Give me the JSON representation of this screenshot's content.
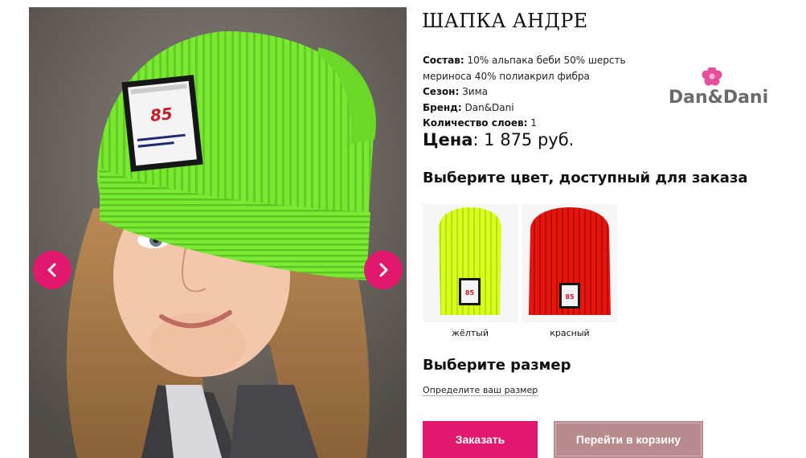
{
  "product": {
    "title": "ШАПКА АНДРЕ",
    "specs": [
      {
        "label": "Состав",
        "value": "10% альпака беби 50% шерсть мериноса 40% полиакрил фибра"
      },
      {
        "label": "Сезон",
        "value": "Зима"
      },
      {
        "label": "Бренд",
        "value": "Dan&Dani"
      },
      {
        "label": "Количество слоев",
        "value": "1"
      }
    ],
    "price_label": "Цена",
    "price_value": "1 875 руб."
  },
  "brand": {
    "name": "Dan&Dani",
    "icon": "flower-icon"
  },
  "gallery": {
    "prev_icon": "chevron-left-icon",
    "next_icon": "chevron-right-icon",
    "patch_number": "85",
    "accent": "#e0196e",
    "hat_color": "#78e830"
  },
  "color_section": {
    "heading": "Выберите цвет, доступный для заказа",
    "options": [
      {
        "label": "жёлтый",
        "color": "#d9ff1f"
      },
      {
        "label": "красный",
        "color": "#e8150e"
      }
    ]
  },
  "size_section": {
    "heading": "Выберите размер",
    "link": "Определите ваш размер"
  },
  "buttons": {
    "order": "Заказать",
    "cart": "Перейти в корзину"
  },
  "colors": {
    "primary": "#e0196e",
    "secondary": "#b88c8e"
  }
}
